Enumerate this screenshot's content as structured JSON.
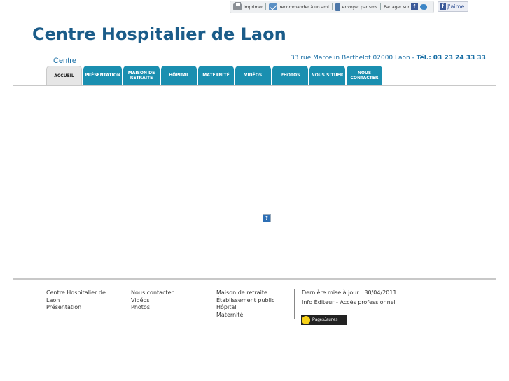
{
  "toolbar": {
    "print": "imprimer",
    "recommend": "recommander à un ami",
    "sms": "envoyer par sms",
    "share": "Partager sur",
    "like": "J'aime"
  },
  "header": {
    "title": "Centre Hospitalier de Laon",
    "address": "33 rue Marcelin Berthelot 02000 Laon  -",
    "tel_label": "Tél.:",
    "tel": "03 23 24 33 33",
    "centre_label": "Centre"
  },
  "nav": {
    "items": [
      {
        "label": "Accueil"
      },
      {
        "label": "Présentation"
      },
      {
        "label": "Maison de retraite"
      },
      {
        "label": "Hôpital"
      },
      {
        "label": "Maternité"
      },
      {
        "label": "Vidéos"
      },
      {
        "label": "Photos"
      },
      {
        "label": "Nous situer"
      },
      {
        "label": "Nous contacter"
      }
    ]
  },
  "main": {
    "missing_plugin": "?"
  },
  "footer": {
    "col1": [
      "Centre Hospitalier de",
      "Laon",
      "Présentation"
    ],
    "col2": [
      "Nous contacter",
      "Vidéos",
      "Photos"
    ],
    "col3": [
      "Maison de retraite :",
      "Établissement public",
      "Hôpital",
      "Maternité"
    ],
    "updated": "Dernière mise à jour : 30/04/2011",
    "info_editeur": "Info Éditeur",
    "dash": " - ",
    "acces_pro": "Accès professionnel",
    "pagesjaunes": "PagesJaunes"
  },
  "colors": {
    "title": "#1b5c89",
    "nav_tab": "#1a8fb0",
    "nav_active": "#e6e6e6"
  }
}
